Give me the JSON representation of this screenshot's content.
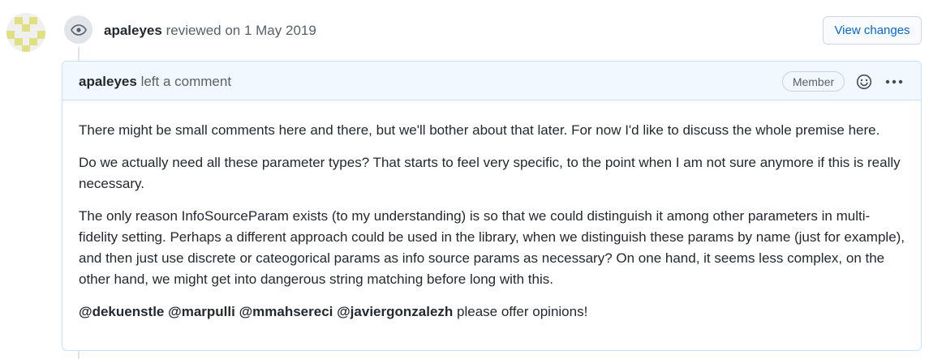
{
  "review": {
    "author": "apaleyes",
    "action": "reviewed on 1 May 2019",
    "view_changes_label": "View changes"
  },
  "comment": {
    "author": "apaleyes",
    "action": "left a comment",
    "badge": "Member",
    "paragraphs": [
      "There might be small comments here and there, but we'll bother about that later. For now I'd like to discuss the whole premise here.",
      "Do we actually need all these parameter types? That starts to feel very specific, to the point when I am not sure anymore if this is really necessary.",
      "The only reason InfoSourceParam exists (to my understanding) is so that we could distinguish it among other parameters in multi-fidelity setting. Perhaps a different approach could be used in the library, when we distinguish these params by name (just for example), and then just use discrete or cateogorical params as info source params as necessary? On one hand, it seems less complex, on the other hand, we might get into dangerous string matching before long with this."
    ],
    "mentions": [
      "@dekuenstle",
      "@marpulli",
      "@mmahsereci",
      "@javiergonzalezh"
    ],
    "mentions_tail": "please offer opinions!"
  },
  "icons": {
    "avatar": "identicon-avatar",
    "review": "eye-icon",
    "emoji": "smiley-icon",
    "more": "kebab-horizontal-icon"
  },
  "colors": {
    "link": "#0366d6",
    "comment_border": "#c8e1ff",
    "comment_header_bg": "#f1f8ff",
    "identicon": "#e0e080"
  }
}
